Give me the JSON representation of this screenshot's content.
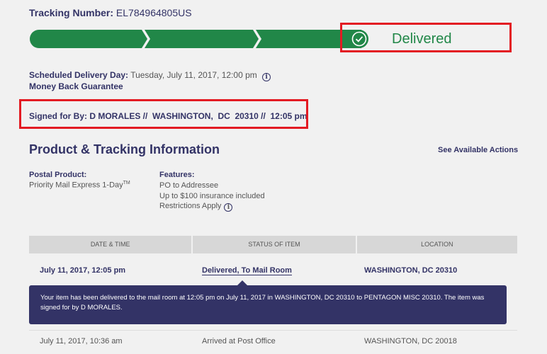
{
  "tracking": {
    "label": "Tracking Number:",
    "number": "EL784964805US"
  },
  "status": {
    "label": "Delivered",
    "color": "#218748",
    "progress_steps_completed": 4,
    "progress_steps_total": 4
  },
  "schedule": {
    "label": "Scheduled Delivery Day:",
    "value": "Tuesday, July 11, 2017, 12:00 pm",
    "info_icon": "info-icon",
    "guarantee": "Money Back Guarantee"
  },
  "signed": {
    "text": "Signed for By: D MORALES //  WASHINGTON,  DC  20310 //  12:05 pm"
  },
  "section": {
    "title": "Product & Tracking Information",
    "actions_link": "See Available Actions"
  },
  "product": {
    "postal_label": "Postal Product:",
    "postal_value": "Priority Mail Express 1-Day",
    "postal_tm": "TM",
    "features_label": "Features:",
    "features": [
      "PO to Addressee",
      "Up to $100 insurance included",
      "Restrictions Apply"
    ]
  },
  "table": {
    "headers": [
      "DATE & TIME",
      "STATUS OF ITEM",
      "LOCATION"
    ],
    "rows": [
      {
        "date": "July 11, 2017, 12:05 pm",
        "status": "Delivered, To Mail Room",
        "location": "WASHINGTON, DC 20310",
        "detail": "Your item has been delivered to the mail room at 12:05 pm on July 11, 2017 in WASHINGTON, DC 20310 to PENTAGON MISC 20310. The item was signed for by D MORALES."
      },
      {
        "date": "July 11, 2017, 10:36 am",
        "status": "Arrived at Post Office",
        "location": "WASHINGTON, DC 20018"
      }
    ]
  },
  "colors": {
    "brand_navy": "#333366",
    "progress_green": "#218748",
    "highlight_red": "#e31b23"
  }
}
